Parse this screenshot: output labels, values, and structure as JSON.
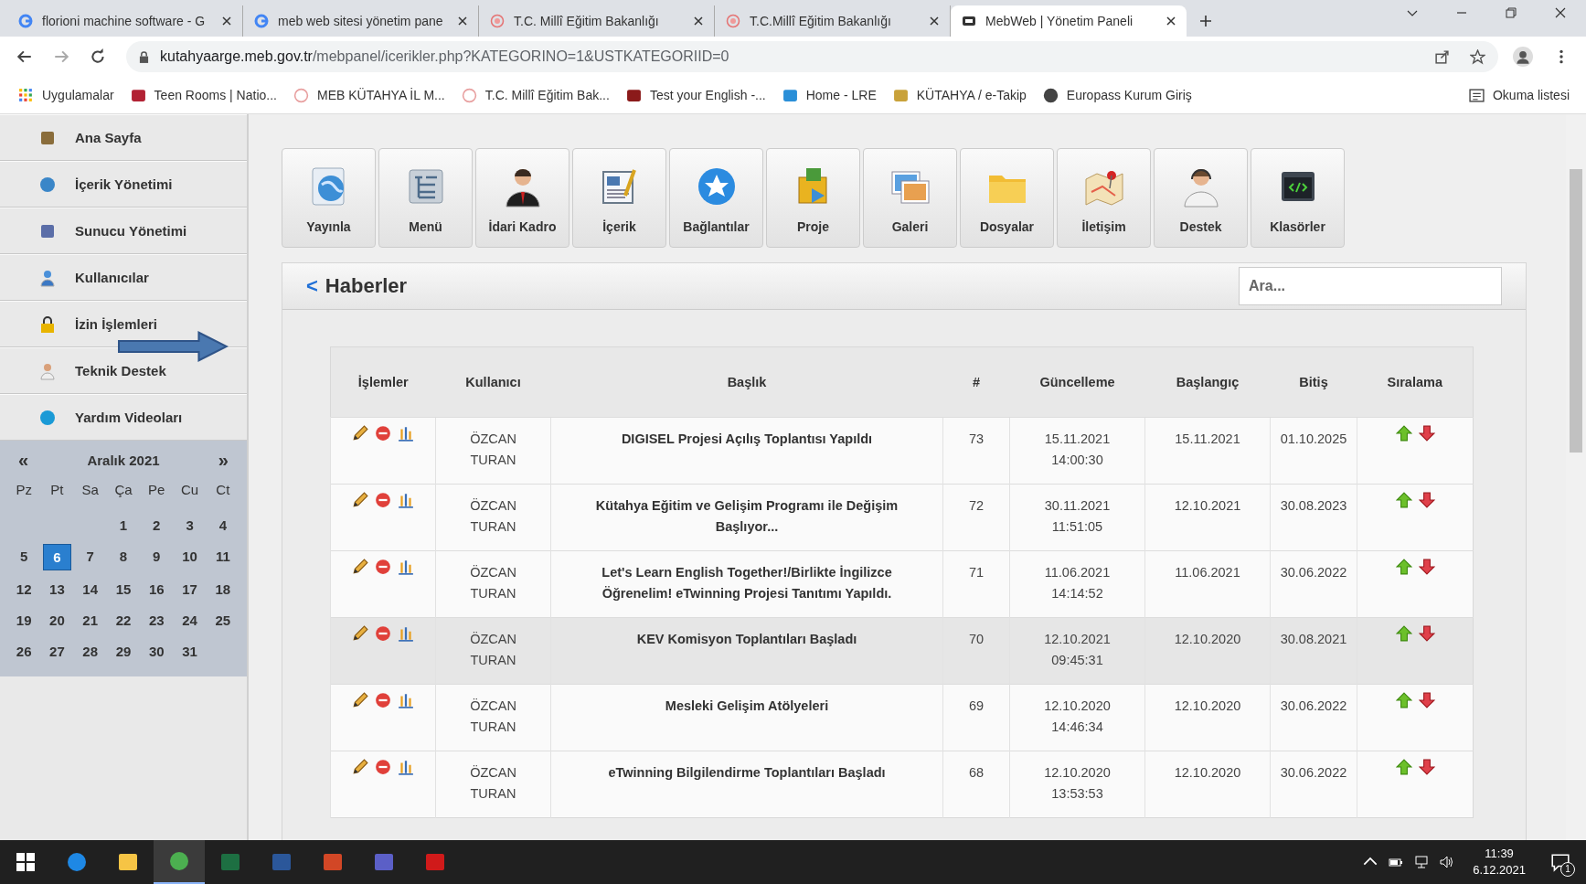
{
  "browser": {
    "tabs": [
      {
        "title": "florioni machine software - G",
        "kind": "google",
        "selected": false
      },
      {
        "title": "meb web sitesi yönetim pane",
        "kind": "google",
        "selected": false
      },
      {
        "title": "T.C. Millî Eğitim Bakanlığı",
        "kind": "meb",
        "selected": false
      },
      {
        "title": "T.C.Millî Eğitim Bakanlığı",
        "kind": "meb",
        "selected": false
      },
      {
        "title": "MebWeb | Yönetim Paneli",
        "kind": "mebweb",
        "selected": true
      }
    ],
    "url_host": "kutahyaarge.meb.gov.tr",
    "url_path": "/mebpanel/icerikler.php?KATEGORINO=1&USTKATEGORIID=0",
    "bookmarks": [
      {
        "label": "Uygulamalar",
        "kind": "apps"
      },
      {
        "label": "Teen Rooms | Natio...",
        "kind": "flag"
      },
      {
        "label": "MEB KÜTAHYA İL M...",
        "kind": "meb"
      },
      {
        "label": "T.C. Millî Eğitim Bak...",
        "kind": "meb"
      },
      {
        "label": "Test your English -...",
        "kind": "shield"
      },
      {
        "label": "Home - LRE",
        "kind": "cube"
      },
      {
        "label": "KÜTAHYA / e-Takip",
        "kind": "torch"
      },
      {
        "label": "Europass Kurum Giriş",
        "kind": "globe"
      }
    ],
    "reading_list": "Okuma listesi"
  },
  "sidebar": {
    "items": [
      {
        "label": "Ana Sayfa",
        "kind": "home"
      },
      {
        "label": "İçerik Yönetimi",
        "kind": "globe"
      },
      {
        "label": "Sunucu Yönetimi",
        "kind": "server"
      },
      {
        "label": "Kullanıcılar",
        "kind": "user"
      },
      {
        "label": "İzin İşlemleri",
        "kind": "lock"
      },
      {
        "label": "Teknik Destek",
        "kind": "support"
      },
      {
        "label": "Yardım Videoları",
        "kind": "help"
      }
    ],
    "calendar": {
      "prev": "«",
      "month": "Aralık 2021",
      "next": "»",
      "weekdays": [
        "Pz",
        "Pt",
        "Sa",
        "Ça",
        "Pe",
        "Cu",
        "Ct"
      ],
      "weeks": [
        [
          {
            "day": "1",
            "selected": false
          },
          {
            "day": "2",
            "selected": false
          },
          {
            "day": "3",
            "selected": false
          },
          {
            "day": "4",
            "selected": false
          }
        ],
        [
          {
            "day": "5",
            "selected": false
          },
          {
            "day": "6",
            "selected": true
          },
          {
            "day": "7",
            "selected": false
          },
          {
            "day": "8",
            "selected": false
          },
          {
            "day": "9",
            "selected": false
          },
          {
            "day": "10",
            "selected": false
          },
          {
            "day": "11",
            "selected": false
          }
        ],
        [
          {
            "day": "12",
            "selected": false
          },
          {
            "day": "13",
            "selected": false
          },
          {
            "day": "14",
            "selected": false
          },
          {
            "day": "15",
            "selected": false
          },
          {
            "day": "16",
            "selected": false
          },
          {
            "day": "17",
            "selected": false
          },
          {
            "day": "18",
            "selected": false
          }
        ],
        [
          {
            "day": "19",
            "selected": false
          },
          {
            "day": "20",
            "selected": false
          },
          {
            "day": "21",
            "selected": false
          },
          {
            "day": "22",
            "selected": false
          },
          {
            "day": "23",
            "selected": false
          },
          {
            "day": "24",
            "selected": false
          },
          {
            "day": "25",
            "selected": false
          }
        ],
        [
          {
            "day": "26",
            "selected": false
          },
          {
            "day": "27",
            "selected": false
          },
          {
            "day": "28",
            "selected": false
          },
          {
            "day": "29",
            "selected": false
          },
          {
            "day": "30",
            "selected": false
          },
          {
            "day": "31",
            "selected": false
          }
        ]
      ]
    }
  },
  "toolbar": [
    {
      "label": "Yayınla",
      "kind": "globe"
    },
    {
      "label": "Menü",
      "kind": "menu"
    },
    {
      "label": "İdari Kadro",
      "kind": "person"
    },
    {
      "label": "İçerik",
      "kind": "document"
    },
    {
      "label": "Bağlantılar",
      "kind": "star"
    },
    {
      "label": "Proje",
      "kind": "project"
    },
    {
      "label": "Galeri",
      "kind": "gallery"
    },
    {
      "label": "Dosyalar",
      "kind": "folder"
    },
    {
      "label": "İletişim",
      "kind": "map"
    },
    {
      "label": "Destek",
      "kind": "support"
    },
    {
      "label": "Klasörler",
      "kind": "code"
    }
  ],
  "panel": {
    "back": "<",
    "title": "Haberler",
    "search": {
      "placeholder": "Ara..."
    }
  },
  "table": {
    "columns": [
      "İşlemler",
      "Kullanıcı",
      "Başlık",
      "#",
      "Güncelleme",
      "Başlangıç",
      "Bitiş",
      "Sıralama"
    ],
    "rows": [
      {
        "user": "ÖZCAN TURAN",
        "title": "DIGISEL Projesi Açılış Toplantısı Yapıldı",
        "no": "73",
        "updated": "15.11.2021 14:00:30",
        "start": "15.11.2021",
        "end": "01.10.2025",
        "highlighted": false
      },
      {
        "user": "ÖZCAN TURAN",
        "title": "Kütahya Eğitim ve Gelişim Programı ile Değişim Başlıyor...",
        "no": "72",
        "updated": "30.11.2021 11:51:05",
        "start": "12.10.2021",
        "end": "30.08.2023",
        "highlighted": false
      },
      {
        "user": "ÖZCAN TURAN",
        "title": "Let's Learn English Together!/Birlikte İngilizce Öğrenelim! eTwinning Projesi Tanıtımı Yapıldı.",
        "no": "71",
        "updated": "11.06.2021 14:14:52",
        "start": "11.06.2021",
        "end": "30.06.2022",
        "highlighted": false
      },
      {
        "user": "ÖZCAN TURAN",
        "title": "KEV Komisyon Toplantıları Başladı",
        "no": "70",
        "updated": "12.10.2021 09:45:31",
        "start": "12.10.2020",
        "end": "30.08.2021",
        "highlighted": true
      },
      {
        "user": "ÖZCAN TURAN",
        "title": "Mesleki Gelişim Atölyeleri",
        "no": "69",
        "updated": "12.10.2020 14:46:34",
        "start": "12.10.2020",
        "end": "30.06.2022",
        "highlighted": false
      },
      {
        "user": "ÖZCAN TURAN",
        "title": "eTwinning Bilgilendirme Toplantıları Başladı",
        "no": "68",
        "updated": "12.10.2020 13:53:53",
        "start": "12.10.2020",
        "end": "30.06.2022",
        "highlighted": false
      }
    ]
  },
  "taskbar": {
    "apps": [
      {
        "kind": "start"
      },
      {
        "kind": "edge"
      },
      {
        "kind": "explorer"
      },
      {
        "kind": "chrome",
        "selected": true
      },
      {
        "kind": "excel"
      },
      {
        "kind": "word"
      },
      {
        "kind": "powerpoint"
      },
      {
        "kind": "teams"
      },
      {
        "kind": "acrobat"
      }
    ],
    "time": "11:39",
    "date": "6.12.2021",
    "notifications": "1"
  }
}
